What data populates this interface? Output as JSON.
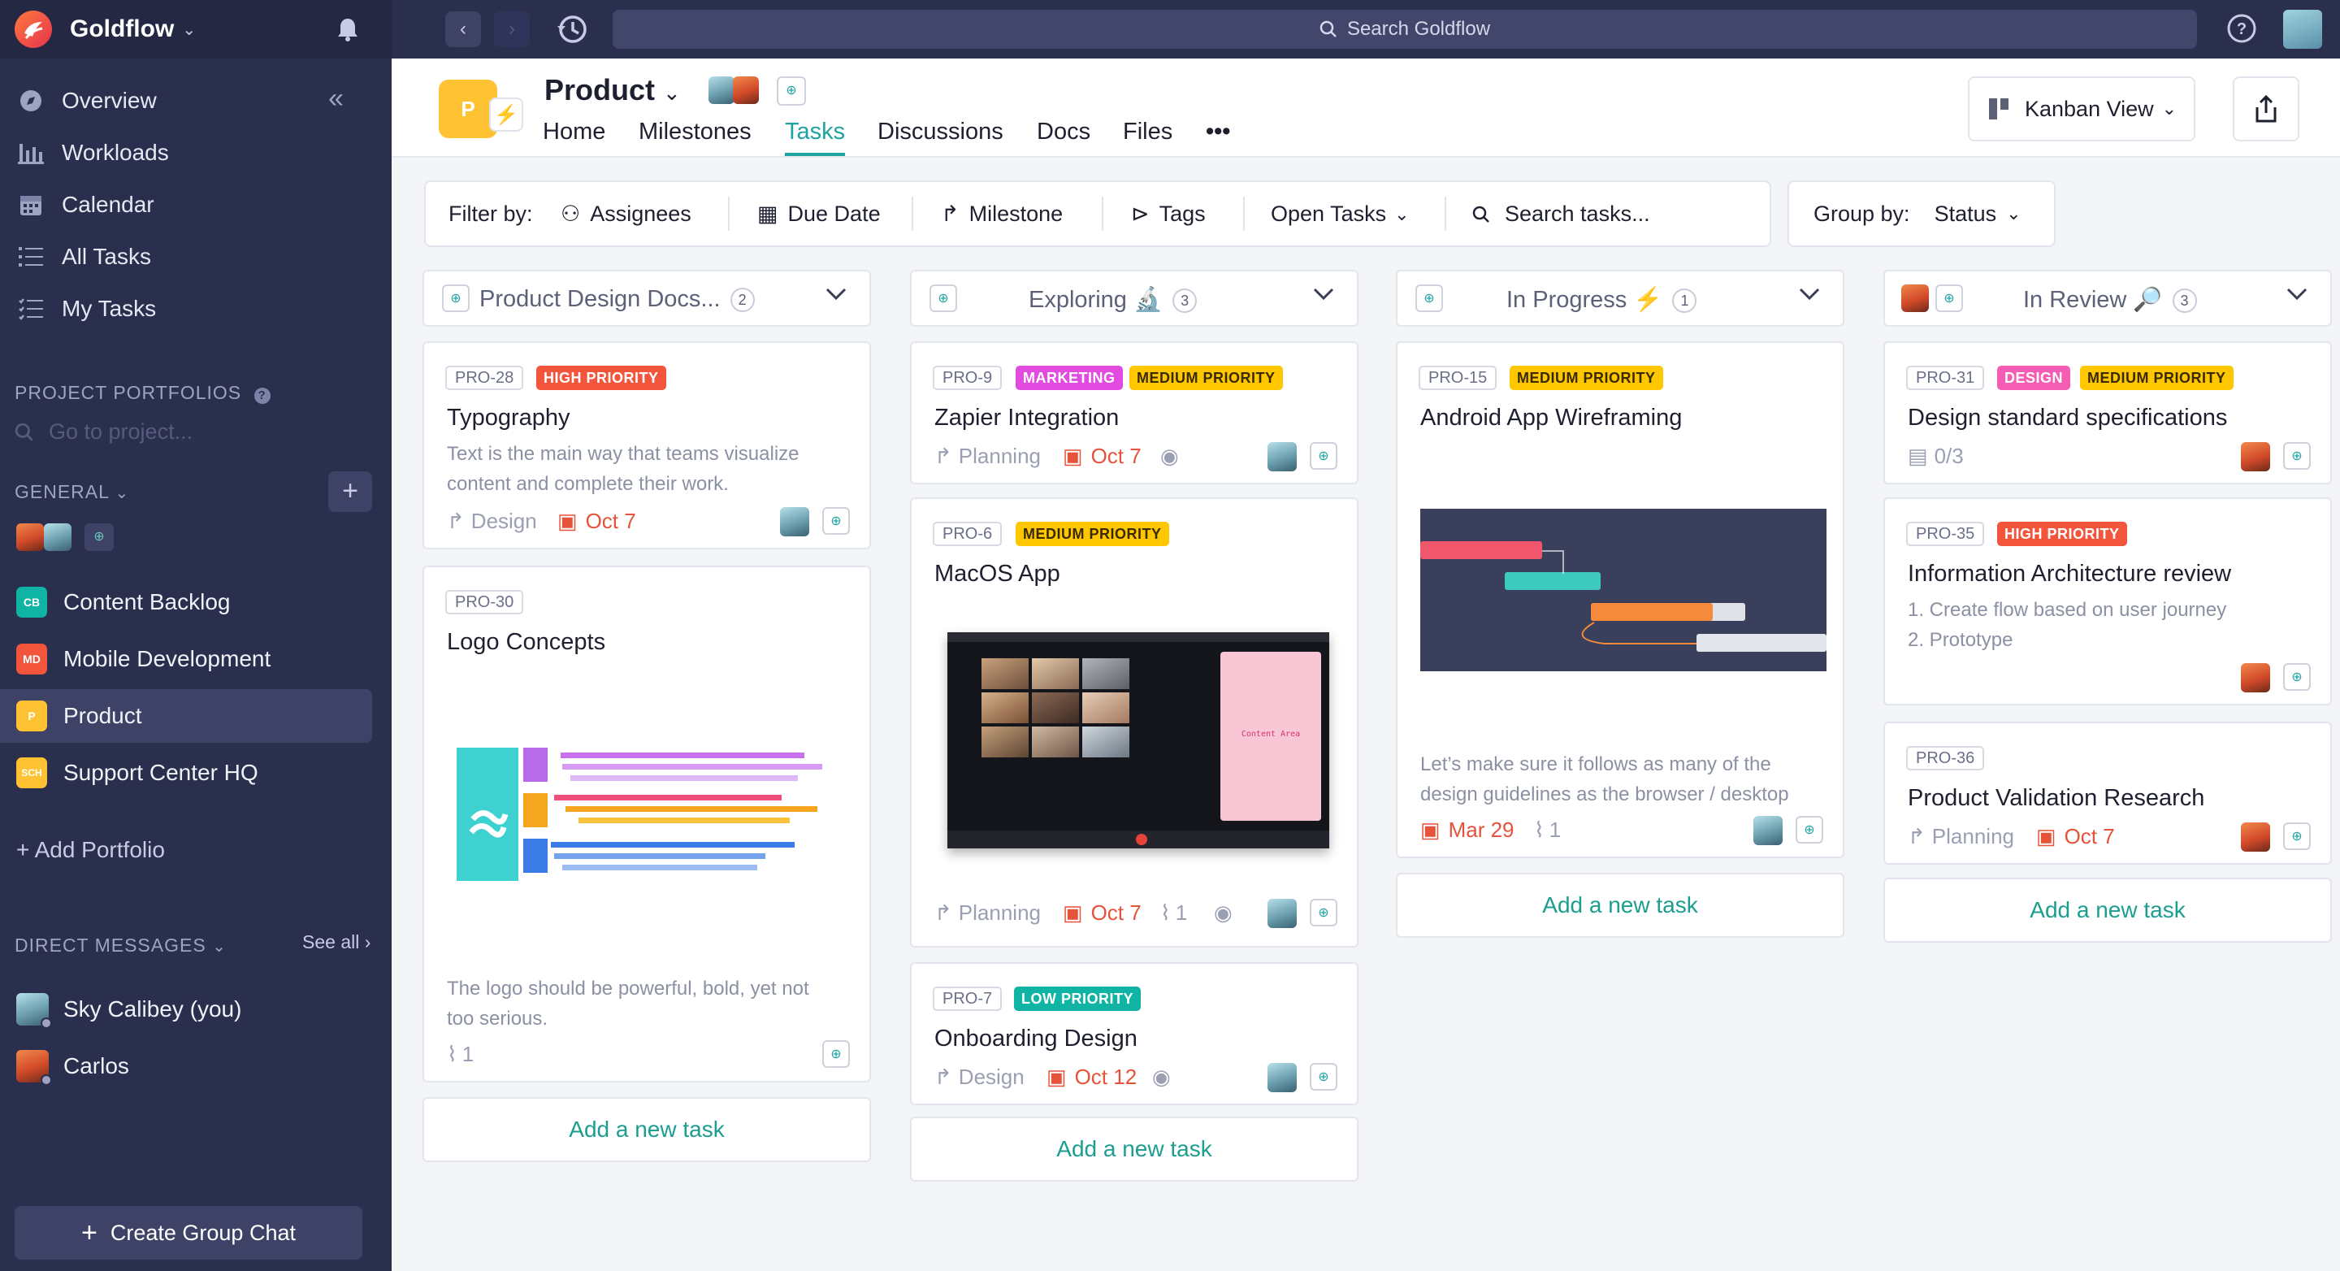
{
  "app": {
    "name": "Goldflow",
    "search_placeholder": "Search Goldflow"
  },
  "sidebar": {
    "nav": [
      {
        "label": "Overview",
        "icon": "overview-icon"
      },
      {
        "label": "Workloads",
        "icon": "workloads-icon"
      },
      {
        "label": "Calendar",
        "icon": "calendar-icon"
      },
      {
        "label": "All Tasks",
        "icon": "all-tasks-icon"
      },
      {
        "label": "My Tasks",
        "icon": "my-tasks-icon"
      }
    ],
    "portfolios_header": "PROJECT PORTFOLIOS",
    "portfolio_search": "Go to project...",
    "general_label": "GENERAL",
    "portfolios": [
      {
        "badge": "CB",
        "label": "Content Backlog",
        "color": "#10b4a4"
      },
      {
        "badge": "MD",
        "label": "Mobile Development",
        "color": "#f3553c"
      },
      {
        "badge": "P",
        "label": "Product",
        "color": "#ffc233"
      },
      {
        "badge": "SCH",
        "label": "Support Center HQ",
        "color": "#ffc233"
      }
    ],
    "add_portfolio": "+ Add Portfolio",
    "dm_header": "DIRECT MESSAGES",
    "see_all": "See all",
    "dms": [
      {
        "label": "Sky Calibey (you)"
      },
      {
        "label": "Carlos"
      }
    ],
    "create_chat": "Create Group Chat"
  },
  "project": {
    "badge": "P",
    "title": "Product",
    "tabs": [
      "Home",
      "Milestones",
      "Tasks",
      "Discussions",
      "Docs",
      "Files"
    ],
    "active_tab": "Tasks",
    "more": "•••",
    "view": "Kanban View"
  },
  "filters": {
    "filter_by": "Filter by:",
    "assignees": "Assignees",
    "due_date": "Due Date",
    "milestone": "Milestone",
    "tags": "Tags",
    "open_tasks": "Open Tasks",
    "search_tasks": "Search tasks...",
    "group_by": "Group by:",
    "group_value": "Status"
  },
  "add_task_label": "Add a new task",
  "columns": [
    {
      "title": "Product Design Docs...",
      "count": "2"
    },
    {
      "title": "Exploring",
      "emoji": "🔬",
      "count": "3"
    },
    {
      "title": "In Progress",
      "emoji": "⚡",
      "count": "1"
    },
    {
      "title": "In Review",
      "emoji": "🔎",
      "count": "3"
    }
  ],
  "cards": {
    "pro28": {
      "id": "PRO-28",
      "tags": [
        "HIGH PRIORITY"
      ],
      "title": "Typography",
      "desc1": "Text is the main way that teams visualize",
      "desc2": "content and complete their work.",
      "milestone": "Design",
      "due": "Oct 7"
    },
    "pro30": {
      "id": "PRO-30",
      "title": "Logo Concepts",
      "desc1": "The logo should be powerful, bold, yet not",
      "desc2": "too serious.",
      "attachments": "1"
    },
    "pro9": {
      "id": "PRO-9",
      "tags": [
        "MARKETING",
        "MEDIUM PRIORITY"
      ],
      "title": "Zapier Integration",
      "milestone": "Planning",
      "due": "Oct 7"
    },
    "pro6": {
      "id": "PRO-6",
      "tags": [
        "MEDIUM PRIORITY"
      ],
      "title": "MacOS App",
      "milestone": "Planning",
      "due": "Oct 7",
      "attachments": "1"
    },
    "pro7": {
      "id": "PRO-7",
      "tags": [
        "LOW PRIORITY"
      ],
      "title": "Onboarding Design",
      "milestone": "Design",
      "due": "Oct 12"
    },
    "pro15": {
      "id": "PRO-15",
      "tags": [
        "MEDIUM PRIORITY"
      ],
      "title": "Android App Wireframing",
      "desc1": "Let’s make sure it follows as many of the",
      "desc2": "design guidelines as the browser / desktop",
      "due": "Mar 29",
      "attachments": "1"
    },
    "pro31": {
      "id": "PRO-31",
      "tags": [
        "DESIGN",
        "MEDIUM PRIORITY"
      ],
      "title": "Design standard specifications",
      "subtasks": "0/3"
    },
    "pro35": {
      "id": "PRO-35",
      "tags": [
        "HIGH PRIORITY"
      ],
      "title": "Information Architecture review",
      "desc1": "1. Create flow based on user journey",
      "desc2": "2. Prototype"
    },
    "pro36": {
      "id": "PRO-36",
      "title": "Product Validation Research",
      "milestone": "Planning",
      "due": "Oct 7"
    }
  },
  "macos_preview": {
    "pink_panel_text": "Content Area"
  }
}
